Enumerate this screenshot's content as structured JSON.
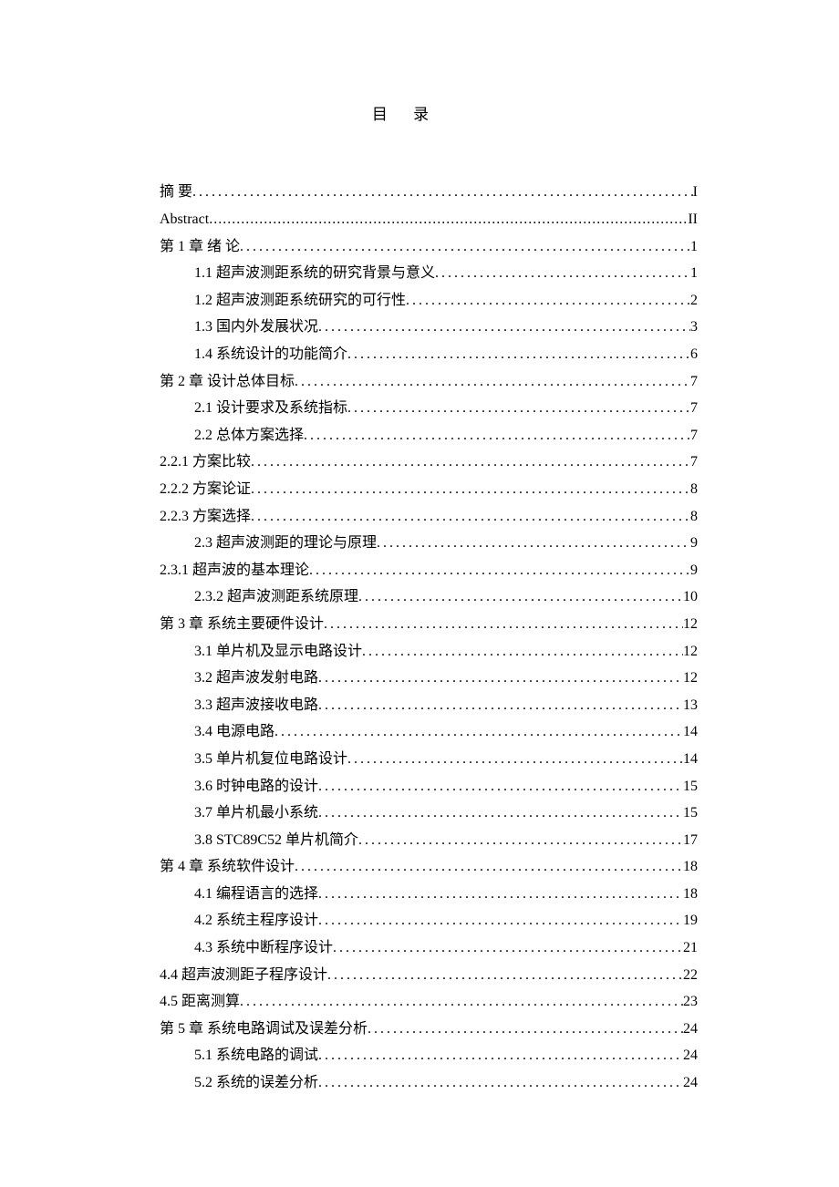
{
  "title": "目  录",
  "items": [
    {
      "label": "摘 要",
      "page": "I",
      "indent": 0,
      "style": "cn"
    },
    {
      "label": "Abstract",
      "page": "II",
      "indent": 0,
      "style": "abstract"
    },
    {
      "label": "第 1 章  绪 论",
      "page": "1",
      "indent": 0,
      "style": "cn"
    },
    {
      "label": "1.1 超声波测距系统的研究背景与意义",
      "page": "1",
      "indent": 1,
      "style": "cn"
    },
    {
      "label": "1.2 超声波测距系统研究的可行性",
      "page": "2",
      "indent": 1,
      "style": "cn"
    },
    {
      "label": "1.3 国内外发展状况",
      "page": "3",
      "indent": 1,
      "style": "cn"
    },
    {
      "label": "1.4 系统设计的功能简介",
      "page": "6",
      "indent": 1,
      "style": "cn"
    },
    {
      "label": "第 2 章  设计总体目标",
      "page": "7",
      "indent": 0,
      "style": "cn"
    },
    {
      "label": "2.1 设计要求及系统指标",
      "page": "7",
      "indent": 1,
      "style": "cn"
    },
    {
      "label": "2.2 总体方案选择",
      "page": "7",
      "indent": 1,
      "style": "cn"
    },
    {
      "label": "2.2.1 方案比较",
      "page": "7",
      "indent": 0,
      "style": "cn"
    },
    {
      "label": "2.2.2 方案论证",
      "page": "8",
      "indent": 0,
      "style": "cn"
    },
    {
      "label": "2.2.3 方案选择",
      "page": "8",
      "indent": 0,
      "style": "cn"
    },
    {
      "label": "2.3 超声波测距的理论与原理",
      "page": "9",
      "indent": 1,
      "style": "cn"
    },
    {
      "label": "2.3.1 超声波的基本理论",
      "page": "9",
      "indent": 0,
      "style": "cn"
    },
    {
      "label": "2.3.2 超声波测距系统原理",
      "page": "10",
      "indent": 1,
      "style": "cn"
    },
    {
      "label": "第 3 章 系统主要硬件设计",
      "page": "12",
      "indent": 0,
      "style": "cn"
    },
    {
      "label": "3.1 单片机及显示电路设计",
      "page": "12",
      "indent": 1,
      "style": "cn"
    },
    {
      "label": "3.2 超声波发射电路",
      "page": "12",
      "indent": 1,
      "style": "cn"
    },
    {
      "label": "3.3 超声波接收电路",
      "page": "13",
      "indent": 1,
      "style": "cn"
    },
    {
      "label": "3.4 电源电路",
      "page": "14",
      "indent": 1,
      "style": "cn"
    },
    {
      "label": "3.5 单片机复位电路设计",
      "page": "14",
      "indent": 1,
      "style": "cn"
    },
    {
      "label": "3.6 时钟电路的设计",
      "page": "15",
      "indent": 1,
      "style": "cn"
    },
    {
      "label": "3.7 单片机最小系统",
      "page": "15",
      "indent": 1,
      "style": "cn"
    },
    {
      "label": "3.8 STC89C52 单片机简介 ",
      "page": "17",
      "indent": 1,
      "style": "cn"
    },
    {
      "label": "第 4 章 系统软件设计",
      "page": "18",
      "indent": 0,
      "style": "cn"
    },
    {
      "label": "4.1 编程语言的选择",
      "page": "18",
      "indent": 1,
      "style": "cn"
    },
    {
      "label": "4.2 系统主程序设计",
      "page": "19",
      "indent": 1,
      "style": "cn"
    },
    {
      "label": "4.3 系统中断程序设计",
      "page": "21",
      "indent": 1,
      "style": "cn"
    },
    {
      "label": "4.4 超声波测距子程序设计",
      "page": "22",
      "indent": 0,
      "style": "cn"
    },
    {
      "label": "4.5 距离测算",
      "page": "23",
      "indent": 0,
      "style": "cn"
    },
    {
      "label": "第 5 章 系统电路调试及误差分析",
      "page": "24",
      "indent": 0,
      "style": "cn"
    },
    {
      "label": "5.1 系统电路的调试",
      "page": "24",
      "indent": 1,
      "style": "cn"
    },
    {
      "label": "5.2 系统的误差分析",
      "page": "24",
      "indent": 1,
      "style": "cn"
    }
  ]
}
